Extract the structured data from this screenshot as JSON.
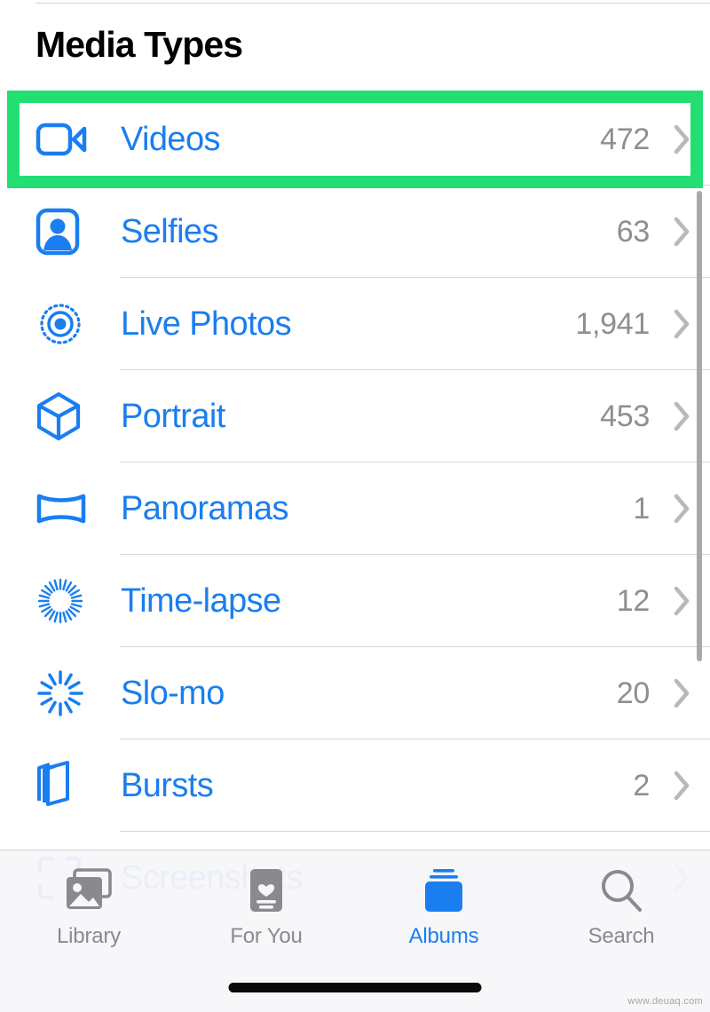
{
  "app": {
    "screen_title": "Media Types",
    "accent_color": "#1a7ef0",
    "highlight_color": "#22de73",
    "count_color": "#8e8e93"
  },
  "media_types": [
    {
      "label": "Videos",
      "count": "472",
      "icon": "video-camera-icon",
      "highlighted": true
    },
    {
      "label": "Selfies",
      "count": "63",
      "icon": "person-portrait-icon",
      "highlighted": false
    },
    {
      "label": "Live Photos",
      "count": "1,941",
      "icon": "live-photo-icon",
      "highlighted": false
    },
    {
      "label": "Portrait",
      "count": "453",
      "icon": "cube-icon",
      "highlighted": false
    },
    {
      "label": "Panoramas",
      "count": "1",
      "icon": "panorama-icon",
      "highlighted": false
    },
    {
      "label": "Time-lapse",
      "count": "12",
      "icon": "timelapse-icon",
      "highlighted": false
    },
    {
      "label": "Slo-mo",
      "count": "20",
      "icon": "slomo-icon",
      "highlighted": false
    },
    {
      "label": "Bursts",
      "count": "2",
      "icon": "bursts-icon",
      "highlighted": false
    },
    {
      "label": "Screenshots",
      "count": "",
      "icon": "screenshot-icon",
      "highlighted": false
    }
  ],
  "chevron_glyph": "›",
  "tabbar": {
    "tabs": [
      {
        "label": "Library",
        "icon": "photos-stack-icon",
        "active": false
      },
      {
        "label": "For You",
        "icon": "for-you-card-icon",
        "active": false
      },
      {
        "label": "Albums",
        "icon": "albums-stack-icon",
        "active": true
      },
      {
        "label": "Search",
        "icon": "magnifier-icon",
        "active": false
      }
    ]
  },
  "watermark": "www.deuaq.com"
}
